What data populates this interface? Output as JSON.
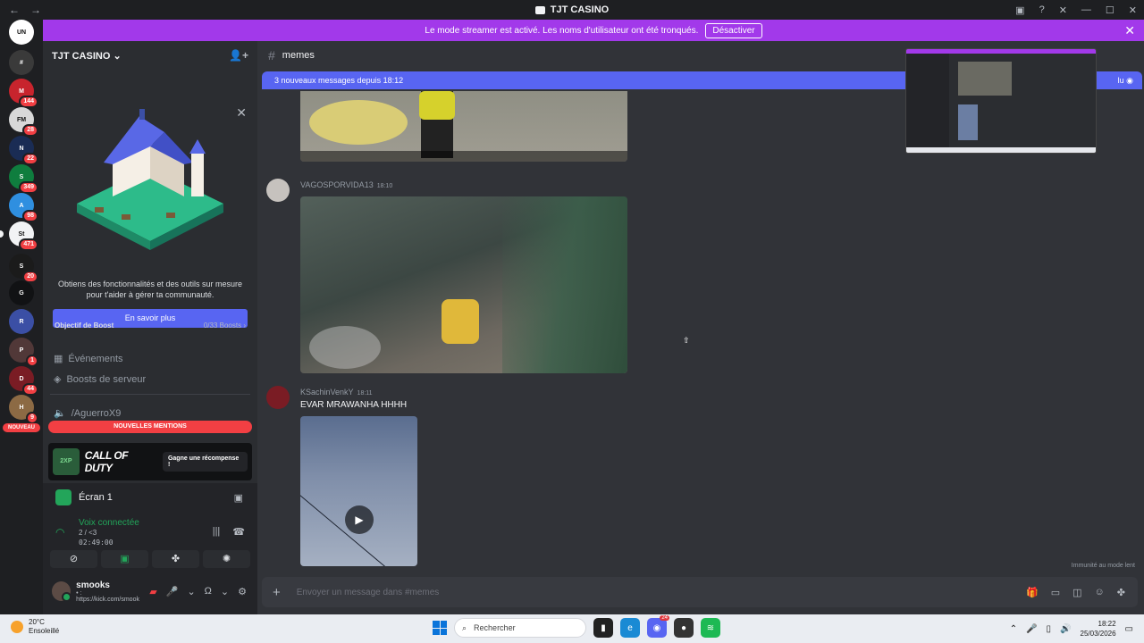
{
  "window": {
    "title": "TJT CASINO",
    "back": "←",
    "forward": "→"
  },
  "banner": {
    "text": "Le mode streamer est activé. Les noms d'utilisateur ont été tronqués.",
    "button": "Désactiver"
  },
  "guilds": [
    {
      "abbr": "UN",
      "color": "#ffffff",
      "badge": ""
    },
    {
      "abbr": "#",
      "color": "#3a3a3a",
      "badge": ""
    },
    {
      "abbr": "M",
      "color": "#c8242d",
      "badge": "144"
    },
    {
      "abbr": "FM",
      "color": "#d8d8d8",
      "badge": "28"
    },
    {
      "abbr": "N",
      "color": "#1a2c54",
      "badge": "22"
    },
    {
      "abbr": "S",
      "color": "#0f7d3e",
      "badge": "349"
    },
    {
      "abbr": "A",
      "color": "#2f8fe0",
      "badge": "98"
    },
    {
      "abbr": "St",
      "color": "#f2f3f5",
      "badge": "471"
    },
    {
      "abbr": "S",
      "color": "#1b1b1b",
      "badge": "20"
    },
    {
      "abbr": "G",
      "color": "#111214",
      "badge": ""
    },
    {
      "abbr": "R",
      "color": "#3b4fa5",
      "badge": ""
    },
    {
      "abbr": "P",
      "color": "#513838",
      "badge": "1"
    },
    {
      "abbr": "D",
      "color": "#7a1c24",
      "badge": "44"
    },
    {
      "abbr": "H",
      "color": "#8c6a44",
      "badge": "9"
    }
  ],
  "nouveau": "NOUVEAU",
  "server": {
    "name": "TJT CASINO",
    "promo_text": "Obtiens des fonctionnalités et des outils sur mesure pour t'aider à gérer ta communauté.",
    "learn_more": "En savoir plus",
    "boost_goal": "Objectif de Boost",
    "boost_progress": "0/33 Boosts",
    "events": "Événements",
    "server_boosts": "Boosts de serveur",
    "channel_partial": "/AguerroX9",
    "new_mentions": "NOUVELLES MENTIONS"
  },
  "cod": {
    "xp": "2XP",
    "brand": "CALL OF DUTY",
    "reward": "Gagne une récompense !"
  },
  "voice": {
    "screen": "Écran 1",
    "connected": "Voix connectée",
    "channel": "2 / <3",
    "time": "02:49:00"
  },
  "user": {
    "name": "smooks",
    "status": "• : https://kick.com/smook"
  },
  "channel": {
    "name": "memes"
  },
  "newbar": {
    "text": "3 nouveaux messages depuis 18:12",
    "mark_read": "lu"
  },
  "messages": [
    {
      "author": "VAGOSPORVIDA13",
      "time": "18:10",
      "text": ""
    },
    {
      "author": "KSachinVenkY",
      "time": "18:11",
      "text": "EVAR MRAWANHA HHHH"
    }
  ],
  "composer": {
    "placeholder": "Envoyer un message dans #memes"
  },
  "immunity": "Immunité au mode lent",
  "taskbar": {
    "temp": "20°C",
    "weather": "Ensoleillé",
    "search": "Rechercher",
    "time": "18:22",
    "date": "25/03/2026",
    "discord_badge": "24"
  }
}
